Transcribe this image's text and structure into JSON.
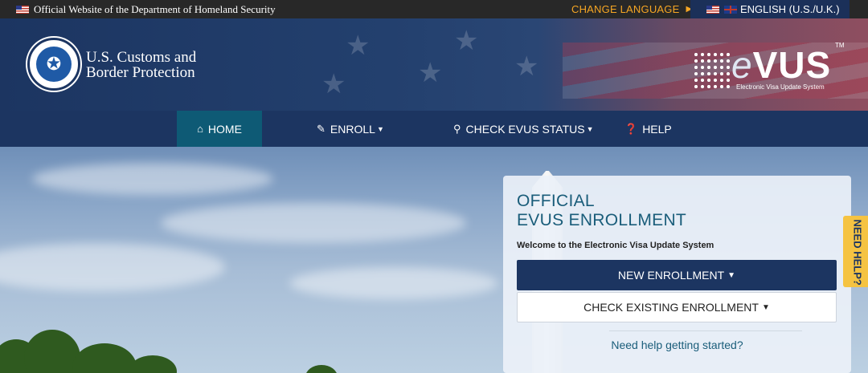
{
  "topbar": {
    "official_text": "Official Website of the Department of Homeland Security",
    "change_language": "CHANGE LANGUAGE",
    "current_language": "ENGLISH (U.S./U.K.)"
  },
  "header": {
    "agency_line1": "U.S. Customs and",
    "agency_line2": "Border Protection",
    "logo_word": "VUS",
    "logo_e": "e",
    "logo_tm": "TM",
    "logo_subtitle": "Electronic Visa Update System"
  },
  "nav": {
    "home": "HOME",
    "enroll": "ENROLL",
    "check_status": "CHECK EVUS STATUS",
    "help": "HELP"
  },
  "panel": {
    "title_line1": "OFFICIAL",
    "title_line2": "EVUS ENROLLMENT",
    "welcome": "Welcome to the Electronic Visa Update System",
    "new_enrollment": "NEW ENROLLMENT",
    "check_existing": "CHECK EXISTING ENROLLMENT",
    "help_link": "Need help getting started?"
  },
  "side_tab": {
    "label": "NEED HELP?"
  },
  "colors": {
    "navy": "#1c3561",
    "active_tab": "#0e5a75",
    "accent_orange": "#f6a623",
    "help_yellow": "#f5c342",
    "link_teal": "#1a5d7a"
  },
  "icons": {
    "home": "home-icon",
    "enroll": "pencil-icon",
    "check_status": "search-icon",
    "help": "question-circle-icon"
  }
}
